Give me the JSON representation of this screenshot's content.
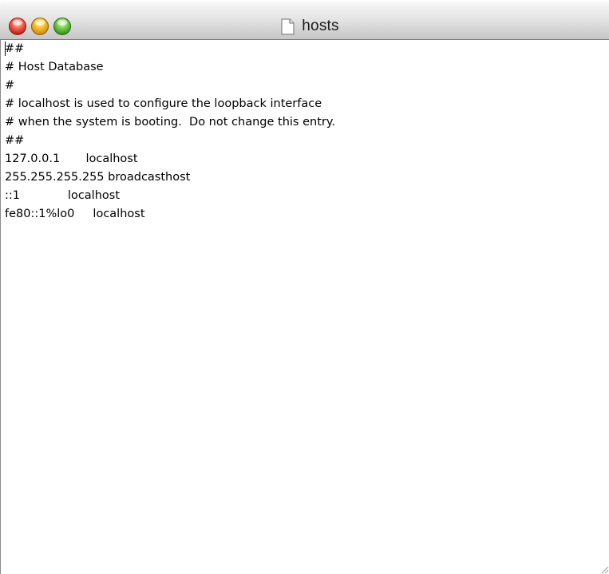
{
  "window": {
    "title": "hosts",
    "controls": {
      "close": "close-button",
      "minimize": "minimize-button",
      "zoom": "zoom-button"
    },
    "title_icon": "document-icon"
  },
  "editor": {
    "lines": [
      "##",
      "# Host Database",
      "#",
      "# localhost is used to configure the loopback interface",
      "# when the system is booting.  Do not change this entry.",
      "##",
      "127.0.0.1       localhost",
      "255.255.255.255 broadcasthost",
      "::1             localhost",
      "fe80::1%lo0     localhost"
    ]
  },
  "colors": {
    "close": "#d8321f",
    "minimize": "#f2a81a",
    "zoom": "#59b434",
    "text": "#000000",
    "background": "#ffffff"
  }
}
